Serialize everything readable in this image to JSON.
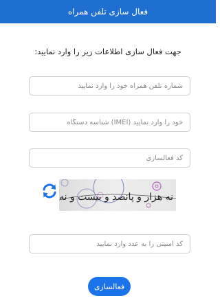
{
  "header": {
    "title": "فعال سازی تلفن همراه"
  },
  "instruction": "جهت فعال سازی اطلاعات زیر را وارد نمایید:",
  "fields": {
    "phone": {
      "placeholder": "شماره تلفن همراه خود را وارد نمایید",
      "value": ""
    },
    "imei": {
      "placeholder": "خود را وارد نمایید (IMEI) شناسه دستگاه",
      "value": ""
    },
    "activation_code": {
      "placeholder": "کد فعالسازی",
      "value": ""
    },
    "captcha": {
      "placeholder": "کد امنیتی را به عدد وارد نمایید",
      "value": ""
    }
  },
  "captcha": {
    "text": "نه هزار و پانصد و بیست و نه"
  },
  "icons": {
    "refresh": "refresh-icon"
  },
  "submit": {
    "label": "فعالسازی"
  },
  "colors": {
    "header": "#1f6fd1",
    "button": "#1a73e8",
    "refresh": "#1a73e8"
  }
}
